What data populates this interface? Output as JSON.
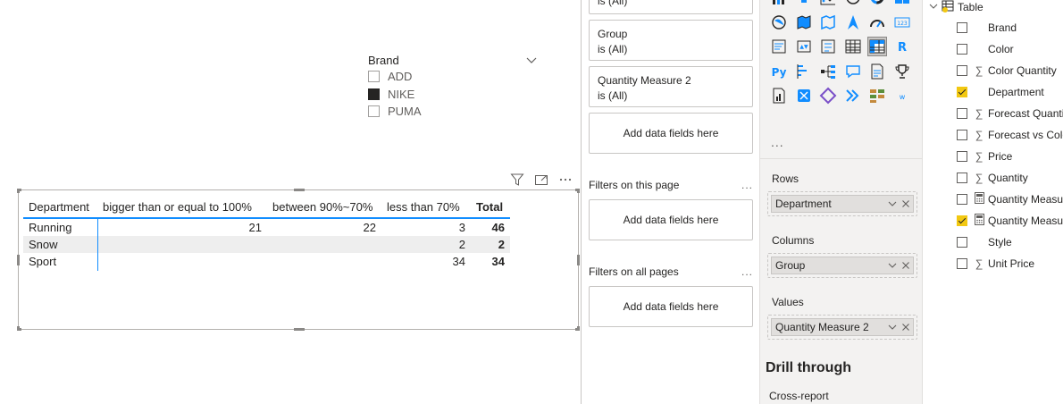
{
  "slicer": {
    "title": "Brand",
    "items": [
      {
        "label": "ADD",
        "checked": false
      },
      {
        "label": "NIKE",
        "checked": true
      },
      {
        "label": "PUMA",
        "checked": false
      }
    ]
  },
  "table_visual": {
    "headers": [
      "Department",
      "bigger than or equal to 100%",
      "between 90%~70%",
      "less than 70%",
      "Total"
    ],
    "rows": [
      {
        "dept": "Running",
        "c1": "21",
        "c2": "22",
        "c3": "3",
        "total": "46"
      },
      {
        "dept": "Snow",
        "c1": "",
        "c2": "",
        "c3": "2",
        "total": "2"
      },
      {
        "dept": "Sport",
        "c1": "",
        "c2": "",
        "c3": "34",
        "total": "34"
      }
    ]
  },
  "filters": {
    "top_card_value": "is (All)",
    "cards": [
      {
        "name": "Group",
        "value": "is (All)"
      },
      {
        "name": "Quantity Measure 2",
        "value": "is (All)"
      }
    ],
    "add_fields_label": "Add data fields here",
    "this_page_label": "Filters on this page",
    "all_pages_label": "Filters on all pages",
    "more": "..."
  },
  "visualizations": {
    "more": "...",
    "rows_label": "Rows",
    "rows_field": "Department",
    "columns_label": "Columns",
    "columns_field": "Group",
    "values_label": "Values",
    "values_field": "Quantity Measure 2",
    "drill_title": "Drill through",
    "cross_report": "Cross-report",
    "icons": [
      "stacked-column-icon",
      "funnel-icon",
      "scatter-icon",
      "pie-icon",
      "donut-icon",
      "treemap-icon",
      "map-icon",
      "filled-map-icon",
      "shape-map-icon",
      "azure-map-icon",
      "gauge-icon",
      "card-icon",
      "multirow-card-icon",
      "kpi-icon",
      "slicer-icon",
      "table-icon",
      "matrix-icon",
      "r-visual-icon",
      "python-visual-icon",
      "key-influencers-icon",
      "decomposition-tree-icon",
      "qa-icon",
      "smart-narrative-icon",
      "trophy-icon",
      "paginated-report-icon",
      "power-apps-icon",
      "power-automate-icon",
      "arcgis-icon",
      "more-visuals-icon",
      "word-icon"
    ]
  },
  "fields": {
    "table_name": "Table",
    "items": [
      {
        "name": "Brand",
        "type": "",
        "checked": false
      },
      {
        "name": "Color",
        "type": "",
        "checked": false
      },
      {
        "name": "Color Quantity",
        "type": "sum",
        "checked": false
      },
      {
        "name": "Department",
        "type": "",
        "checked": true
      },
      {
        "name": "Forecast Quanti",
        "type": "sum",
        "checked": false
      },
      {
        "name": "Forecast vs Colo",
        "type": "sum",
        "checked": false
      },
      {
        "name": "Price",
        "type": "sum",
        "checked": false
      },
      {
        "name": "Quantity",
        "type": "sum",
        "checked": false
      },
      {
        "name": "Quantity Measu",
        "type": "calc",
        "checked": false
      },
      {
        "name": "Quantity Measu",
        "type": "calc",
        "checked": true
      },
      {
        "name": "Style",
        "type": "",
        "checked": false
      },
      {
        "name": "Unit Price",
        "type": "sum",
        "checked": false
      }
    ]
  }
}
